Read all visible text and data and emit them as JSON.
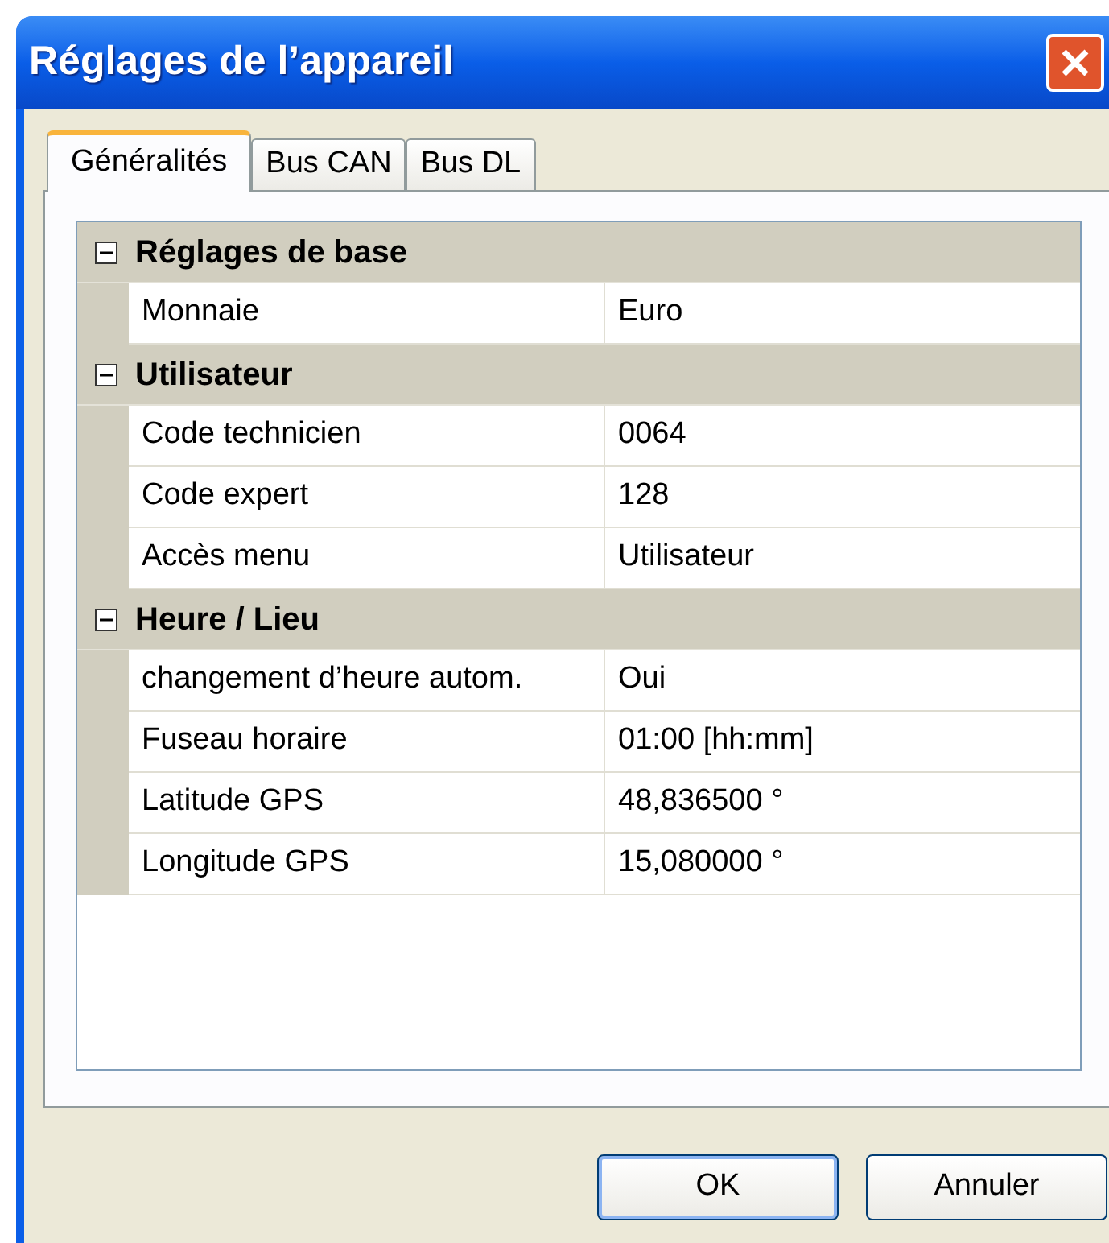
{
  "window": {
    "title": "Réglages de l’appareil"
  },
  "tabs": [
    {
      "label": "Généralités",
      "selected": true
    },
    {
      "label": "Bus CAN",
      "selected": false
    },
    {
      "label": "Bus DL",
      "selected": false
    }
  ],
  "sections": [
    {
      "title": "Réglages de base",
      "expanded": true,
      "rows": [
        {
          "name": "Monnaie",
          "value": "Euro"
        }
      ]
    },
    {
      "title": "Utilisateur",
      "expanded": true,
      "rows": [
        {
          "name": "Code technicien",
          "value": "0064"
        },
        {
          "name": "Code expert",
          "value": "128"
        },
        {
          "name": "Accès menu",
          "value": "Utilisateur"
        }
      ]
    },
    {
      "title": "Heure / Lieu",
      "expanded": true,
      "rows": [
        {
          "name": "changement d’heure autom.",
          "value": "Oui"
        },
        {
          "name": "Fuseau horaire",
          "value": "01:00 [hh:mm]"
        },
        {
          "name": "Latitude GPS",
          "value": "48,836500 °"
        },
        {
          "name": "Longitude GPS",
          "value": "15,080000 °"
        }
      ]
    }
  ],
  "buttons": [
    "OK",
    "Annuler"
  ]
}
